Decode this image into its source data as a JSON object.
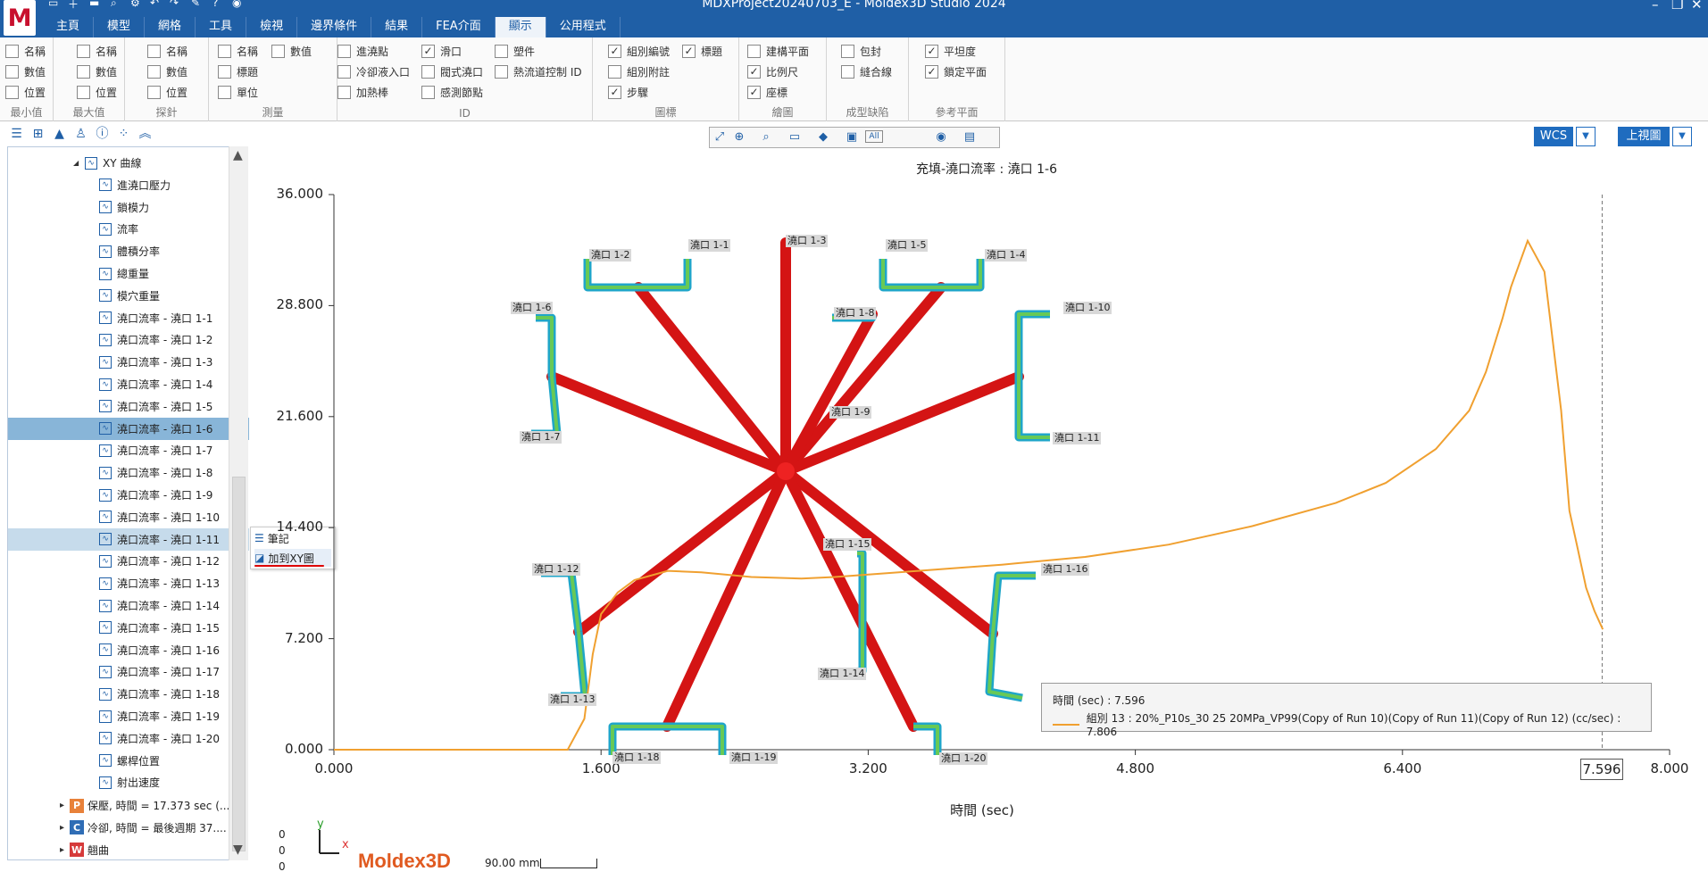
{
  "app": {
    "title": "MDXProject20240703_E - Moldex3D Studio 2024",
    "logo": "M"
  },
  "tabs": [
    "主頁",
    "模型",
    "網格",
    "工具",
    "檢視",
    "邊界條件",
    "結果",
    "FEA介面",
    "顯示",
    "公用程式"
  ],
  "ribbon": {
    "groups": [
      {
        "title": "最小值",
        "items": [
          "名稱",
          "數值",
          "位置"
        ]
      },
      {
        "title": "最大值",
        "items": [
          "名稱",
          "數值",
          "位置"
        ]
      },
      {
        "title": "探針",
        "items": [
          "名稱",
          "數值",
          "位置"
        ]
      },
      {
        "title": "測量",
        "items": [
          "名稱",
          "數值",
          "標題",
          "單位"
        ]
      },
      {
        "title": "ID",
        "items": [
          "進澆點",
          "滑口",
          "塑件",
          "冷卻液入口",
          "閥式澆口",
          "熱流道控制 ID",
          "加熱棒",
          "感測節點"
        ]
      },
      {
        "title": "圖標",
        "items": [
          "組別編號",
          "標題",
          "組別附註",
          "步驟"
        ]
      },
      {
        "title": "繪圖",
        "items": [
          "建構平面",
          "比例尺",
          "座標"
        ]
      },
      {
        "title": "成型缺陷",
        "items": [
          "包封",
          "縫合線"
        ]
      },
      {
        "title": "參考平面",
        "items": [
          "平坦度",
          "鎖定平面"
        ]
      }
    ]
  },
  "tree": {
    "items": [
      "XY 曲線",
      "進澆口壓力",
      "鎖模力",
      "流率",
      "體積分率",
      "總重量",
      "模穴重量",
      "澆口流率 - 澆口 1-1",
      "澆口流率 - 澆口 1-2",
      "澆口流率 - 澆口 1-3",
      "澆口流率 - 澆口 1-4",
      "澆口流率 - 澆口 1-5",
      "澆口流率 - 澆口 1-6",
      "澆口流率 - 澆口 1-7",
      "澆口流率 - 澆口 1-8",
      "澆口流率 - 澆口 1-9",
      "澆口流率 - 澆口 1-10",
      "澆口流率 - 澆口 1-11",
      "澆口流率 - 澆口 1-12",
      "澆口流率 - 澆口 1-13",
      "澆口流率 - 澆口 1-14",
      "澆口流率 - 澆口 1-15",
      "澆口流率 - 澆口 1-16",
      "澆口流率 - 澆口 1-17",
      "澆口流率 - 澆口 1-18",
      "澆口流率 - 澆口 1-19",
      "澆口流率 - 澆口 1-20",
      "螺桿位置",
      "射出速度"
    ],
    "bottom": [
      {
        "badge": "P",
        "color": "#e8813a",
        "label": "保壓, 時間 = 17.373 sec (..."
      },
      {
        "badge": "C",
        "color": "#2f6db5",
        "label": "冷卻, 時間 = 最後週期 37...."
      },
      {
        "badge": "W",
        "color": "#d63a3a",
        "label": "翹曲"
      }
    ]
  },
  "context_menu": [
    "筆記",
    "加到XY圖"
  ],
  "view": {
    "wcs": "WCS",
    "view_label": "上視圖",
    "all": "All"
  },
  "chart_data": {
    "type": "line",
    "title": "充填-澆口流率 : 澆口 1-6",
    "xlabel": "時間 (sec)",
    "ylabel": "",
    "xlim": [
      0,
      8
    ],
    "ylim": [
      0,
      36
    ],
    "xticks": [
      "0.000",
      "1.600",
      "3.200",
      "4.800",
      "6.400",
      "8.000"
    ],
    "yticks": [
      "0.000",
      "7.200",
      "14.400",
      "21.600",
      "28.800",
      "36.000"
    ],
    "marker_x": "7.596",
    "series": [
      {
        "name": "組別 13 : 20%_P10s_30 25 20MPa_VP99(Copy of Run 10)(Copy of Run 11)(Copy of Run 12) (cc/sec)",
        "color": "#f0a030",
        "x": [
          0,
          1.4,
          1.5,
          1.55,
          1.6,
          1.7,
          1.8,
          2.0,
          2.2,
          2.5,
          2.8,
          3.0,
          3.5,
          4.0,
          4.5,
          5.0,
          5.5,
          6.0,
          6.3,
          6.6,
          6.8,
          6.9,
          7.0,
          7.05,
          7.15,
          7.25,
          7.35,
          7.4,
          7.45,
          7.5,
          7.55,
          7.6
        ],
        "y": [
          0,
          0,
          2.0,
          6.2,
          8.8,
          10.2,
          11.0,
          11.6,
          11.5,
          11.2,
          11.1,
          11.2,
          11.6,
          12.0,
          12.5,
          13.3,
          14.5,
          16.0,
          17.3,
          19.5,
          22.0,
          24.5,
          28.0,
          30.0,
          33.0,
          31.0,
          22.0,
          15.5,
          13.0,
          10.5,
          9.0,
          7.8
        ]
      }
    ],
    "tooltip": {
      "time": "時間 (sec) : 7.596",
      "series": "組別 13 : 20%_P10s_30 25 20MPa_VP99(Copy of Run 10)(Copy of Run 11)(Copy of Run 12) (cc/sec) : 7.806"
    }
  },
  "gate_labels": [
    "澆口 1-1",
    "澆口 1-2",
    "澆口 1-3",
    "澆口 1-4",
    "澆口 1-5",
    "澆口 1-6",
    "澆口 1-7",
    "澆口 1-8",
    "澆口 1-9",
    "澆口 1-10",
    "澆口 1-11",
    "澆口 1-12",
    "澆口 1-13",
    "澆口 1-14",
    "澆口 1-15",
    "澆口 1-16",
    "澆口 1-18",
    "澆口 1-19",
    "澆口 1-20"
  ],
  "footer": {
    "brand": "Moldex3D",
    "scale": "90.00 mm",
    "coords": [
      "0",
      "0",
      "0"
    ],
    "axis_y": "y",
    "axis_x": "x"
  }
}
